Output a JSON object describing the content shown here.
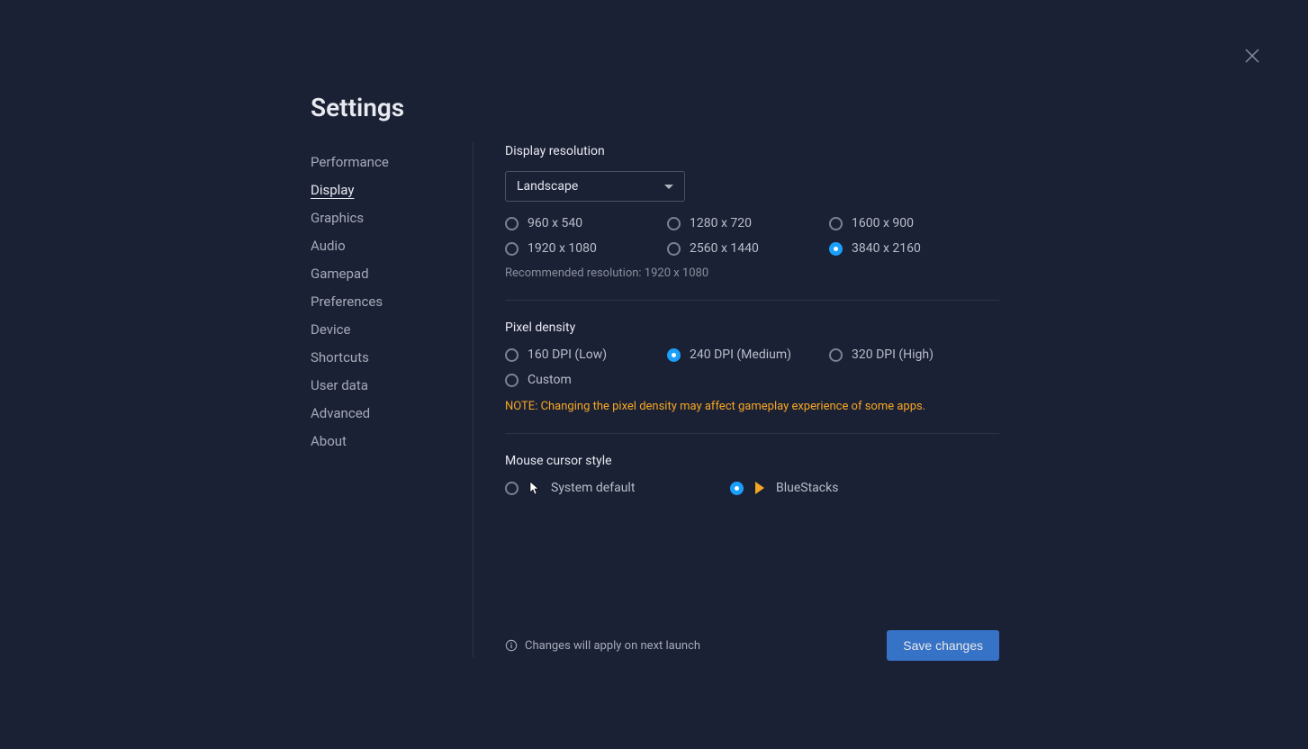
{
  "title": "Settings",
  "sidebar": {
    "items": [
      {
        "label": "Performance",
        "name": "sidebar-item-performance",
        "active": false
      },
      {
        "label": "Display",
        "name": "sidebar-item-display",
        "active": true
      },
      {
        "label": "Graphics",
        "name": "sidebar-item-graphics",
        "active": false
      },
      {
        "label": "Audio",
        "name": "sidebar-item-audio",
        "active": false
      },
      {
        "label": "Gamepad",
        "name": "sidebar-item-gamepad",
        "active": false
      },
      {
        "label": "Preferences",
        "name": "sidebar-item-preferences",
        "active": false
      },
      {
        "label": "Device",
        "name": "sidebar-item-device",
        "active": false
      },
      {
        "label": "Shortcuts",
        "name": "sidebar-item-shortcuts",
        "active": false
      },
      {
        "label": "User data",
        "name": "sidebar-item-user-data",
        "active": false
      },
      {
        "label": "Advanced",
        "name": "sidebar-item-advanced",
        "active": false
      },
      {
        "label": "About",
        "name": "sidebar-item-about",
        "active": false
      }
    ]
  },
  "display": {
    "resolution_heading": "Display resolution",
    "orientation_selected": "Landscape",
    "resolutions": [
      {
        "label": "960 x 540",
        "selected": false
      },
      {
        "label": "1280 x 720",
        "selected": false
      },
      {
        "label": "1600 x 900",
        "selected": false
      },
      {
        "label": "1920 x 1080",
        "selected": false
      },
      {
        "label": "2560 x 1440",
        "selected": false
      },
      {
        "label": "3840 x 2160",
        "selected": true
      }
    ],
    "recommended_text": "Recommended resolution: 1920 x 1080",
    "pixel_density_heading": "Pixel density",
    "densities": [
      {
        "label": "160 DPI (Low)",
        "selected": false
      },
      {
        "label": "240 DPI (Medium)",
        "selected": true
      },
      {
        "label": "320 DPI (High)",
        "selected": false
      },
      {
        "label": "Custom",
        "selected": false
      }
    ],
    "density_note": "NOTE: Changing the pixel density may affect gameplay experience of some apps.",
    "cursor_heading": "Mouse cursor style",
    "cursor_options": [
      {
        "label": "System default",
        "selected": false,
        "icon": "system"
      },
      {
        "label": "BlueStacks",
        "selected": true,
        "icon": "bluestacks"
      }
    ]
  },
  "footer": {
    "note": "Changes will apply on next launch",
    "save_label": "Save changes"
  }
}
